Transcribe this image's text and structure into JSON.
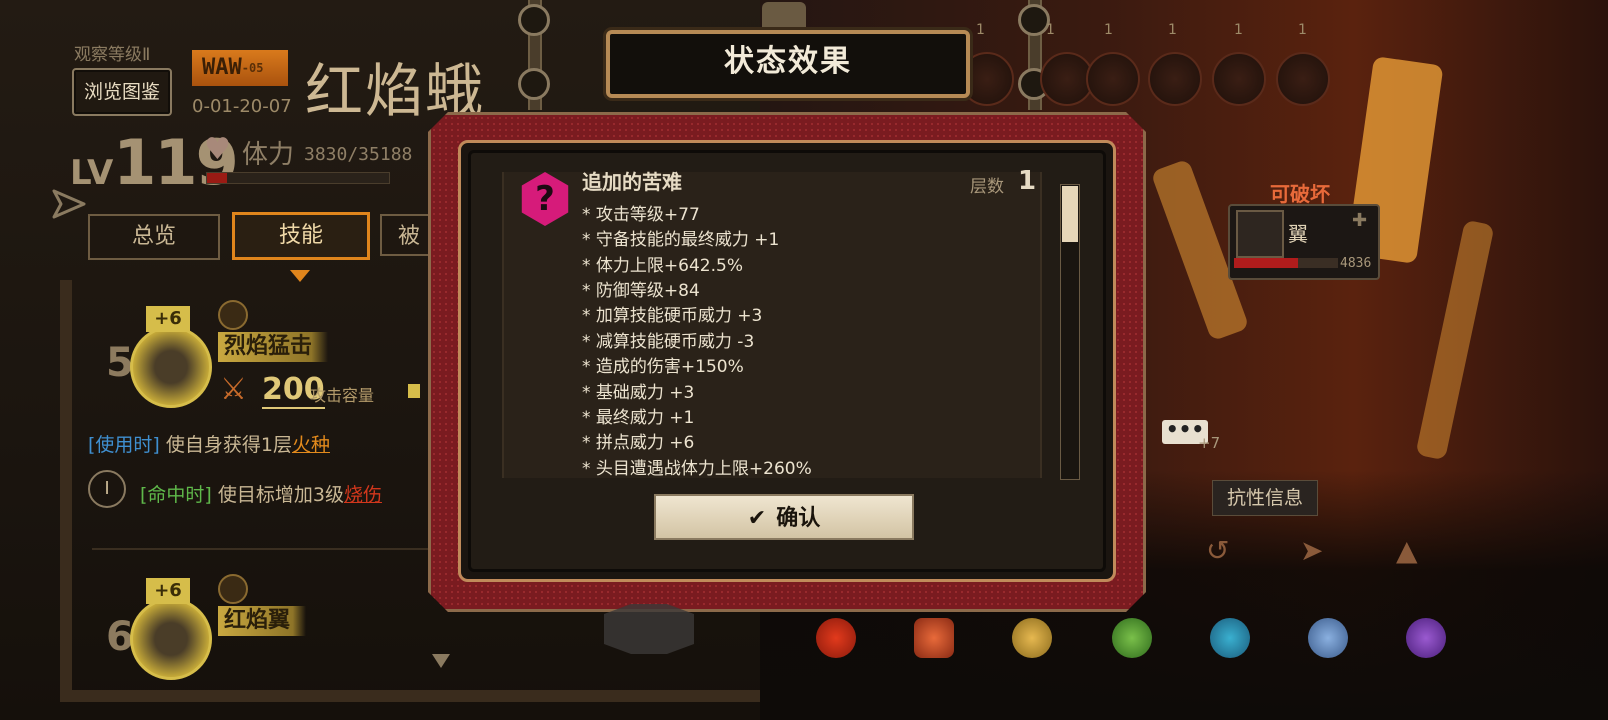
{
  "header": {
    "observe_level": "观察等级Ⅱ",
    "browse_button": "浏览图鉴",
    "risk_tag": "WAW",
    "risk_sub": "-05",
    "code": "0-01-20-07",
    "name": "红焰蛾",
    "lv_label": "LV",
    "lv_value": "119",
    "hp_label": "体力",
    "hp_value": "3830/35188",
    "hp_fraction": 0.109
  },
  "tabs": [
    {
      "label": "总览",
      "active": false
    },
    {
      "label": "技能",
      "active": true
    },
    {
      "label": "被动",
      "active": false
    }
  ],
  "skills": [
    {
      "index": "5",
      "plus": "+6",
      "name": "烈焰猛击",
      "power": "200",
      "power_label": "攻击容量",
      "on_use_tag": "[使用时]",
      "on_use_text": "使自身获得1层",
      "on_use_keyword": "火种",
      "on_hit_marker": "Ⅰ",
      "on_hit_tag": "[命中时]",
      "on_hit_text": "使目标增加3级",
      "on_hit_keyword": "烧伤"
    },
    {
      "index": "6",
      "plus": "+6",
      "name": "红焰翼"
    }
  ],
  "top_counters": [
    "1",
    "1",
    "1",
    "1",
    "1",
    "1"
  ],
  "dialog": {
    "title": "状态效果",
    "effect_name": "追加的苦难",
    "layers_label": "层数",
    "layers_value": "1",
    "lines": [
      "* 攻击等级+77",
      "* 守备技能的最终威力 +1",
      "* 体力上限+642.5%",
      "* 防御等级+84",
      "* 加算技能硬币威力 +3",
      "* 减算技能硬币威力 -3",
      "* 造成的伤害+150%",
      "* 基础威力 +3",
      "* 最终威力 +1",
      "* 拼点威力 +6",
      "* 头目遭遇战体力上限+260%"
    ],
    "confirm": "确认"
  },
  "right": {
    "breakable_label": "可破坏",
    "part_name": "翼",
    "part_value": "4836",
    "part_fraction": 0.62,
    "more_button": "•••",
    "more_count": "+7",
    "resist_button": "抗性信息"
  },
  "colors": {
    "accent_orange": "#e0851c",
    "magenta": "#d61b7a",
    "hp_red": "#9a1b14"
  },
  "resist_icons": [
    "fire-icon",
    "bleed-icon",
    "tremor-icon",
    "rupture-icon",
    "sinking-icon",
    "poise-icon",
    "charge-icon"
  ]
}
